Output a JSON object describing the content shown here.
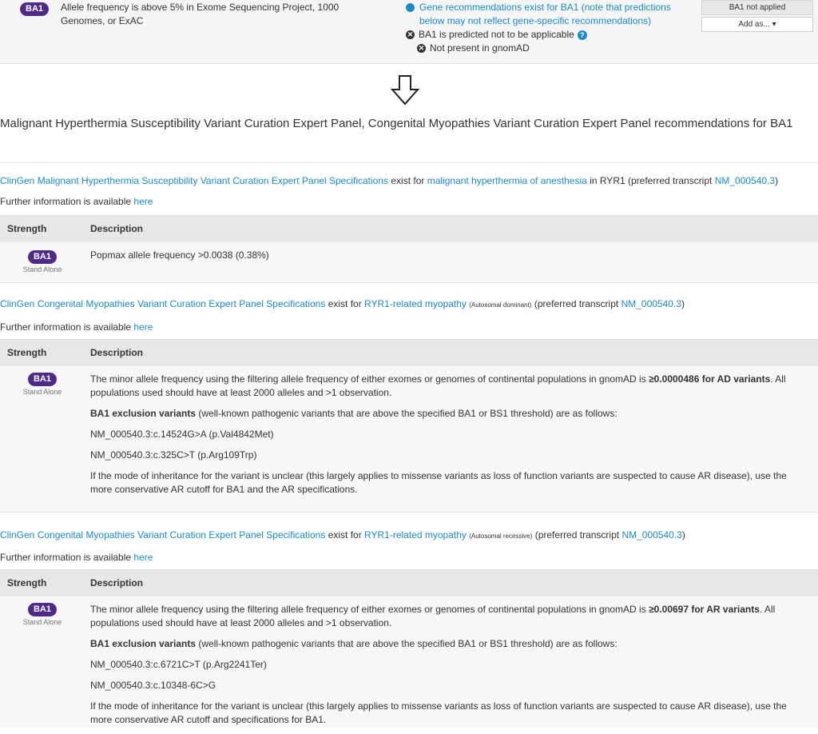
{
  "top": {
    "code": "BA1",
    "description": "Allele frequency is above 5% in Exome Sequencing Project, 1000 Genomes, or ExAC",
    "gene_recommendation": "Gene recommendations exist for BA1 (note that predictions below may not reflect gene-specific recommendations)",
    "not_applicable": "BA1 is predicted not to be applicable",
    "not_present": "Not present in gnomAD",
    "status_button": "BA1 not applied",
    "add_as": "Add as... ▾"
  },
  "panel_title": "Malignant Hyperthermia Susceptibility Variant Curation Expert Panel, Congenital Myopathies Variant Curation Expert Panel recommendations for BA1",
  "table_headers": {
    "strength": "Strength",
    "description": "Description"
  },
  "further_info": {
    "text": "Further information is available",
    "link": "here"
  },
  "strength": {
    "code": "BA1",
    "label": "Stand Alone"
  },
  "specs": [
    {
      "panel_link": "ClinGen Malignant Hyperthermia Susceptibility Variant Curation Expert Panel Specifications",
      "exist_for": "exist for",
      "condition": "malignant hyperthermia of anesthesia",
      "inheritance": "",
      "gene_text": "in RYR1 (preferred transcript",
      "transcript": "NM_000540.3",
      "close": ")",
      "desc": "Popmax allele frequency >0.0038 (0.38%)"
    },
    {
      "panel_link": "ClinGen Congenital Myopathies Variant Curation Expert Panel Specifications",
      "exist_for": "exist for",
      "condition": "RYR1-related myopathy",
      "inheritance": "(Autosomal dominant)",
      "gene_text": "(preferred transcript",
      "transcript": "NM_000540.3",
      "close": ")",
      "desc_a": "The minor allele frequency using the filtering allele frequency of either exomes or genomes of continental populations in gnomAD is ",
      "desc_bold": "≥0.0000486 for AD variants",
      "desc_b": ". All populations used should have at least 2000 alleles and >1 observation.",
      "excl_bold": "BA1 exclusion variants",
      "excl_rest": " (well-known pathogenic variants that are above the specified BA1 or BS1 threshold) are as follows:",
      "variant1": "NM_000540.3:c.14524G>A (p.Val4842Met)",
      "variant2": "NM_000540.3:c.325C>T (p.Arg109Trp)",
      "note": "If the mode of inheritance for the variant is unclear (this largely applies to missense variants as loss of function variants are suspected to cause AR disease), use the more conservative AR cutoff for BA1 and the AR specifications."
    },
    {
      "panel_link": "ClinGen Congenital Myopathies Variant Curation Expert Panel Specifications",
      "exist_for": "exist for",
      "condition": "RYR1-related myopathy",
      "inheritance": "(Autosomal recessive)",
      "gene_text": "(preferred transcript",
      "transcript": "NM_000540.3",
      "close": ")",
      "desc_a": "The minor allele frequency using the filtering allele frequency of either exomes or genomes of continental populations in gnomAD is ",
      "desc_bold": "≥0.00697 for AR variants",
      "desc_b": ". All populations used should have at least 2000 alleles and >1 observation.",
      "excl_bold": "BA1 exclusion variants",
      "excl_rest": " (well-known pathogenic variants that are above the specified BA1 or BS1 threshold) are as follows:",
      "variant1": "NM_000540.3:c.6721C>T (p.Arg2241Ter)",
      "variant2": "NM_000540.3:c.10348-6C>G",
      "note": "If the mode of inheritance for the variant is unclear (this largely applies to missense variants as loss of function variants are suspected to cause AR disease), use the more conservative AR cutoff and specifications for BA1."
    }
  ]
}
